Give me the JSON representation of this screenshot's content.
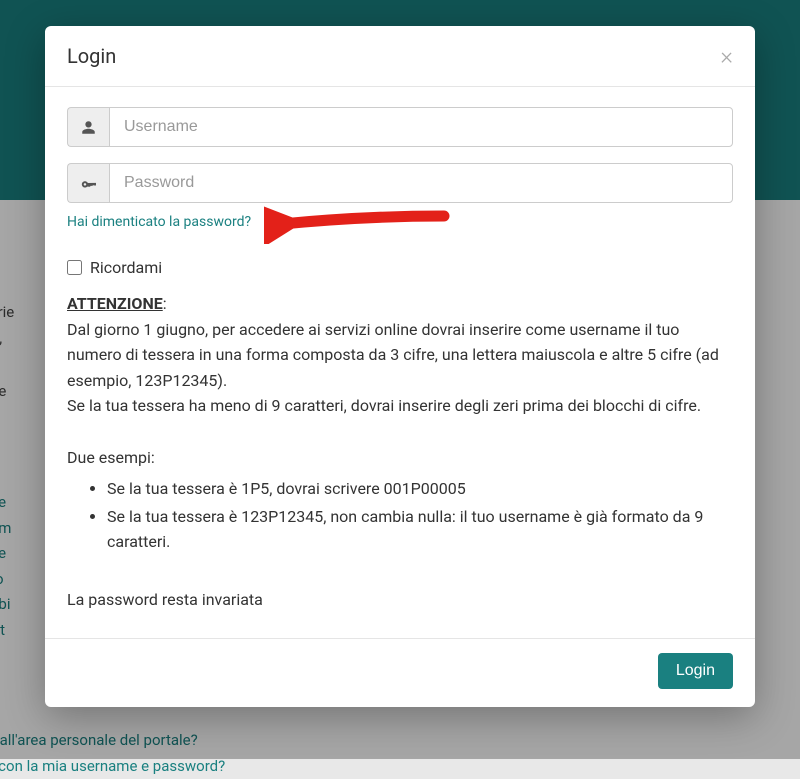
{
  "modal": {
    "title": "Login",
    "username_placeholder": "Username",
    "password_placeholder": "Password",
    "forgot_link": "Hai dimenticato la password?",
    "remember_label": "Ricordami",
    "submit_label": "Login"
  },
  "notice": {
    "attention_label": "ATTENZIONE",
    "paragraph1": "Dal giorno 1 giugno, per accedere ai servizi online dovrai inserire come username il tuo numero di tessera in una forma composta da 3 cifre, una lettera maiuscola e altre 5 cifre (ad esempio, 123P12345).",
    "paragraph1b": "Se la tua tessera ha meno di 9 caratteri, dovrai inserire degli zeri prima dei blocchi di cifre.",
    "examples_heading": "Due esempi:",
    "examples": [
      "Se la tua tessera è 1P5, dovrai scrivere 001P00005",
      "Se la tua tessera è 123P12345, non cambia nulla: il tuo username è già formato da 9 caratteri."
    ],
    "password_note": "La password resta invariata"
  },
  "background": {
    "lines": [
      "a serie",
      "ema,",
      "",
      "ssere",
      "",
      "e",
      "",
      "ca ge",
      "a com",
      "ca pe",
      "si tro",
      "una bi",
      "ornat"
    ],
    "link1": "accesso all'area personale del portale?",
    "link2": "l portale con la mia username e password?"
  },
  "colors": {
    "accent": "#1a8080",
    "arrow": "#e32119"
  }
}
